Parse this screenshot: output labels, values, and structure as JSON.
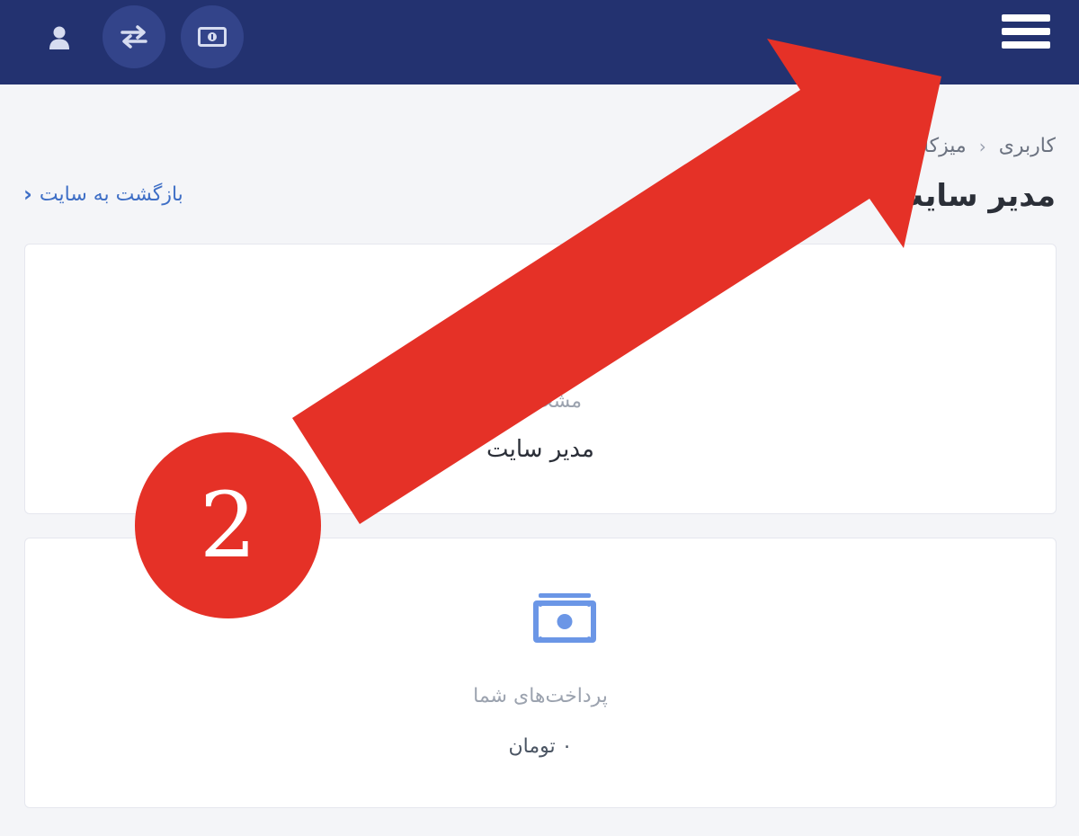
{
  "header": {
    "icons": [
      "user-icon",
      "transfer-icon",
      "money-icon",
      "menu-icon"
    ],
    "background": "#233270"
  },
  "breadcrumb": {
    "items": [
      "کاربری",
      "میزکار"
    ]
  },
  "page": {
    "title": "مدیر سایت",
    "back_link": "بازگشت به سایت"
  },
  "cards": [
    {
      "label": "مشخصات",
      "value": "مدیر سایت"
    },
    {
      "icon": "money-icon",
      "label": "پرداخت‌های شما",
      "value": "۰ تومان"
    }
  ],
  "annotation": {
    "step_number": "2",
    "color": "#e53127"
  },
  "colors": {
    "accent": "#3f6fc6",
    "icon_blue": "#6b96e6"
  }
}
